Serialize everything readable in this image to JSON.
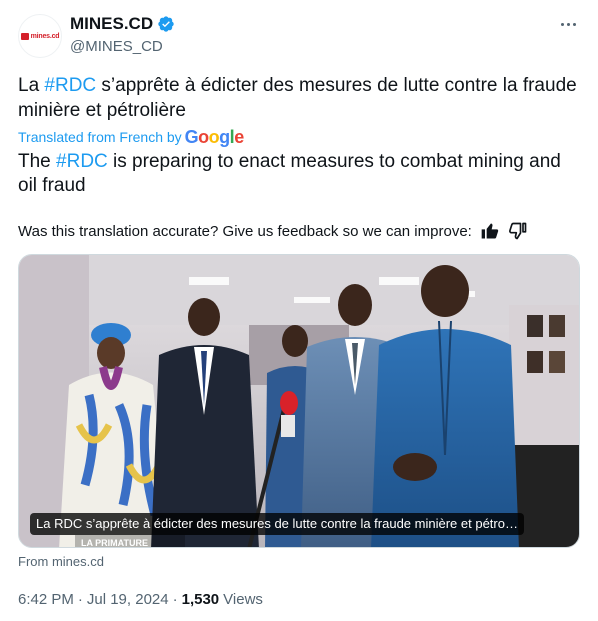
{
  "author": {
    "avatar_text": "mines.cd",
    "display_name": "MINES.CD",
    "handle": "@MINES_CD",
    "verified": true
  },
  "tweet": {
    "text_prefix": "La ",
    "hashtag": "#RDC",
    "text_suffix": " s’apprête à édicter des mesures de lutte contre la fraude minière et pétrolière"
  },
  "translation": {
    "label": "Translated from French by",
    "provider": "Google",
    "text_prefix": "The ",
    "hashtag": "#RDC",
    "text_suffix": " is preparing to enact measures to combat mining and oil fraud"
  },
  "feedback": {
    "question": "Was this translation accurate? Give us feedback so we can improve:",
    "thumbs_up_icon": "thumbs-up-icon",
    "thumbs_down_icon": "thumbs-down-icon"
  },
  "media": {
    "caption": "La RDC s’apprête à édicter des mesures de lutte contre la fraude minière et pétro…",
    "watermark_text": "LA PRIMATURE"
  },
  "source": "From mines.cd",
  "meta": {
    "time": "6:42 PM",
    "date": "Jul 19, 2024",
    "views_count": "1,530",
    "views_label": "Views"
  },
  "colors": {
    "accent": "#1d9bf0",
    "secondary_text": "#536471",
    "primary_text": "#0f1419",
    "brand_red": "#d4202a"
  }
}
